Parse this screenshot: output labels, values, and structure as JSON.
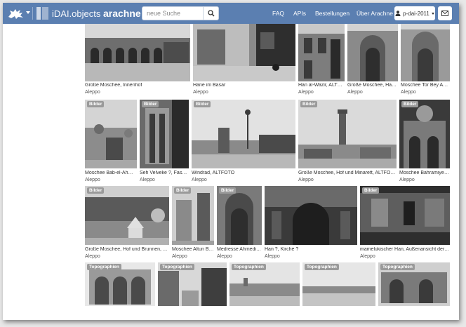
{
  "navbar": {
    "brand_light": "iDAI.objects",
    "brand_bold": "arachne",
    "search_placeholder": "neue Suche",
    "links": [
      "FAQ",
      "APIs",
      "Bestellungen",
      "Über Arachne"
    ],
    "user_label": "p-dai-2011",
    "colors": {
      "bar": "#5b7fb1"
    }
  },
  "results": {
    "row1": [
      {
        "title": "Große Moschee, Innenhof",
        "place": "Aleppo"
      },
      {
        "title": "Hane im Basar",
        "place": "Aleppo"
      },
      {
        "title": "Han al-Wazir, ALTFO...",
        "place": "Aleppo"
      },
      {
        "title": "Große Moschee, Haupt...",
        "place": "Aleppo"
      },
      {
        "title": "Moschee Tor Bey Adl...",
        "place": "Aleppo"
      }
    ],
    "row2": [
      {
        "badge": "Bilder",
        "title": "Moschee Bab-el-Ahma...",
        "place": "Aleppo"
      },
      {
        "badge": "Bilder",
        "title": "Seh Velveke ?, Fassad...",
        "place": "Aleppo"
      },
      {
        "badge": "Bilder",
        "title": "Windrad, ALTFOTO",
        "place": "Aleppo"
      },
      {
        "badge": "Bilder",
        "title": "Große Moschee, Hof und Minarett, ALTFOTO",
        "place": "Aleppo"
      },
      {
        "badge": "Bilder",
        "title": "Moschee Bahramiye,M...",
        "place": "Aleppo"
      }
    ],
    "row3": [
      {
        "badge": "Bilder",
        "title": "Große Moschee, Hof und Brunnen, ALTF...",
        "place": "Aleppo"
      },
      {
        "badge": "Bilder",
        "title": "Moschee Altun Bo...",
        "place": "Aleppo"
      },
      {
        "badge": "Bilder",
        "title": "Medresse Ahmediy...",
        "place": "Aleppo"
      },
      {
        "badge": "Bilder",
        "title": "Han ?, Kirche ?",
        "place": "Aleppo"
      },
      {
        "badge": "Bilder",
        "title": "mamelukischer Han, Außenansicht der Fas...",
        "place": "Aleppo"
      }
    ],
    "row4": [
      {
        "badge": "Topographien"
      },
      {
        "badge": "Topographien"
      },
      {
        "badge": "Topographien"
      },
      {
        "badge": "Topographien"
      },
      {
        "badge": "Topographien"
      }
    ]
  }
}
